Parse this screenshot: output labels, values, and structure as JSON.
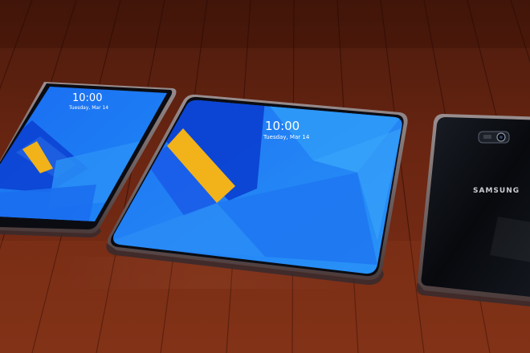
{
  "left_phone": {
    "time": "10:00",
    "date": "Tuesday, Mar 14"
  },
  "center_tablet": {
    "time": "10:00",
    "date": "Tuesday, Mar 14"
  },
  "right_phone": {
    "brand": "SAMSUNG"
  },
  "colors": {
    "wood_dark": "#3d1208",
    "wood_light": "#8a3a1c",
    "screen_blue": "#1e7af0",
    "screen_deep": "#0a3fd0",
    "stripe_yellow": "#f2b21a",
    "phone_back": "#0c0f14"
  }
}
